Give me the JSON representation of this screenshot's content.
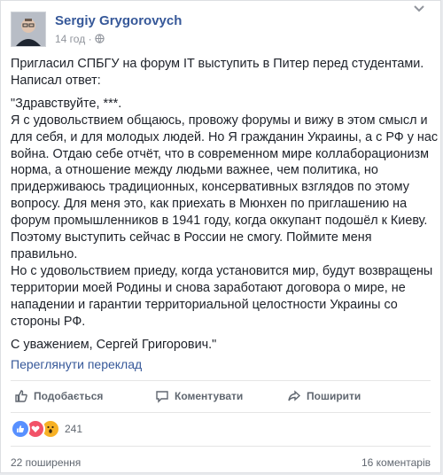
{
  "author": {
    "name": "Sergiy Grygorovych",
    "time": "14 год"
  },
  "post": {
    "intro_lines": [
      "Пригласил СПБГУ на форум IT выступить в Питер перед студентами.",
      "Написал ответ:"
    ],
    "letter_lines": [
      "\"Здравствуйте, ***.",
      "Я с удовольствием общаюсь, провожу форумы и вижу в этом смысл и",
      "для себя, и для молодых людей. Но Я гражданин Украины, а с РФ у нас",
      "война. Отдаю себе отчёт, что в современном мире коллаборационизм",
      "норма, а отношение между людьми важнее, чем политика, но",
      "придерживаюсь традиционных, консервативных взглядов по этому",
      "вопросу. Для меня это, как приехать в Мюнхен по приглашению на",
      "форум промышленников в 1941 году, когда оккупант подошёл к Киеву.",
      "Поэтому выступить сейчас в России не смогу. Поймите меня",
      "правильно.",
      "Но с удовольствием приеду, когда установится мир, будут возвращены",
      "территории моей Родины и снова заработают договора о мире, не",
      "нападении и гарантии территориальной целостности Украины со",
      "стороны РФ."
    ],
    "closing_lines": [
      "С уважением, Сергей Григорович.\""
    ]
  },
  "translate_link": "Переглянути переклад",
  "actions": {
    "like": "Подобається",
    "comment": "Коментувати",
    "share": "Поширити"
  },
  "reactions": {
    "count": "241",
    "icons": [
      "like-icon",
      "love-icon",
      "wow-icon"
    ],
    "colors": {
      "like": "#5890ff",
      "love": "#f25268",
      "wow": "#f7b125"
    }
  },
  "footer": {
    "shares": "22 поширення",
    "comments": "16 коментарів"
  },
  "colors": {
    "link": "#365899",
    "text": "#1d2129",
    "meta": "#90949c"
  }
}
